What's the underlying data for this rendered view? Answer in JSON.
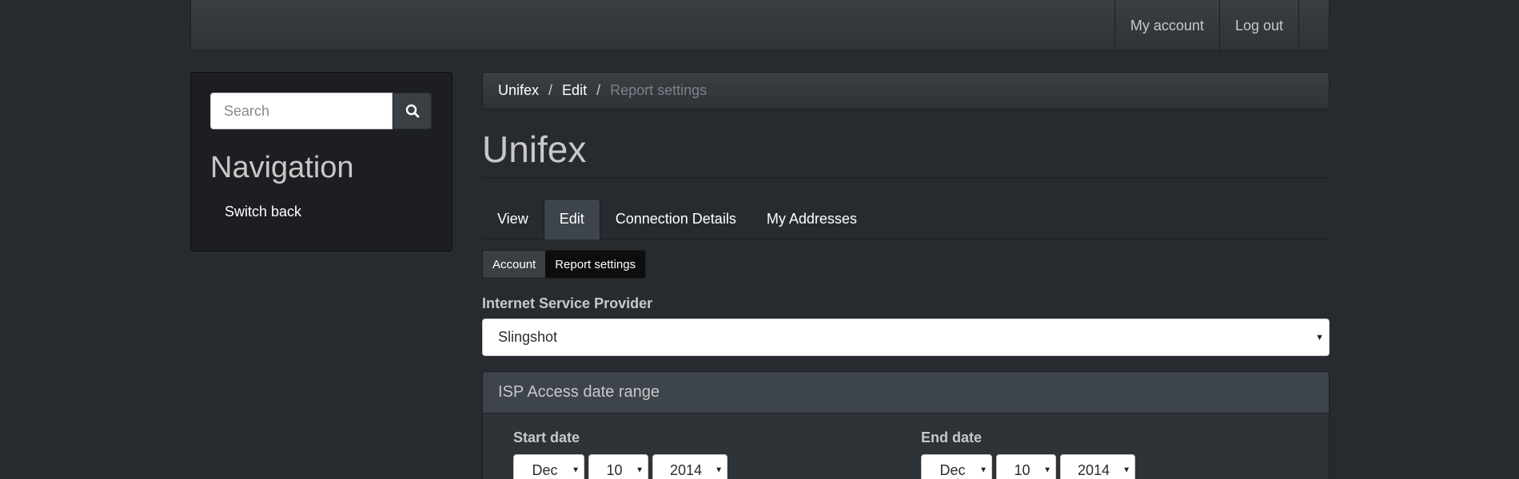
{
  "topbar": {
    "nav": [
      {
        "label": "My account"
      },
      {
        "label": "Log out"
      }
    ]
  },
  "sidebar": {
    "search": {
      "placeholder": "Search",
      "icon": "search-icon"
    },
    "title": "Navigation",
    "items": [
      {
        "label": "Switch back"
      }
    ]
  },
  "breadcrumb": {
    "items": [
      {
        "label": "Unifex"
      },
      {
        "label": "Edit"
      }
    ],
    "current": "Report settings",
    "separator": "/"
  },
  "page": {
    "title": "Unifex"
  },
  "tabs": [
    {
      "label": "View",
      "active": false
    },
    {
      "label": "Edit",
      "active": true
    },
    {
      "label": "Connection Details",
      "active": false
    },
    {
      "label": "My Addresses",
      "active": false
    }
  ],
  "subtabs": [
    {
      "label": "Account",
      "active": false
    },
    {
      "label": "Report settings",
      "active": true
    }
  ],
  "form": {
    "isp_label": "Internet Service Provider",
    "isp_value": "Slingshot",
    "date_range": {
      "heading": "ISP Access date range",
      "start": {
        "label": "Start date",
        "month": "Dec",
        "day": "10",
        "year": "2014"
      },
      "end": {
        "label": "End date",
        "month": "Dec",
        "day": "10",
        "year": "2014"
      }
    }
  },
  "colors": {
    "background": "#272b30",
    "panel": "#1c1e22",
    "active_tab": "#3e444c"
  }
}
